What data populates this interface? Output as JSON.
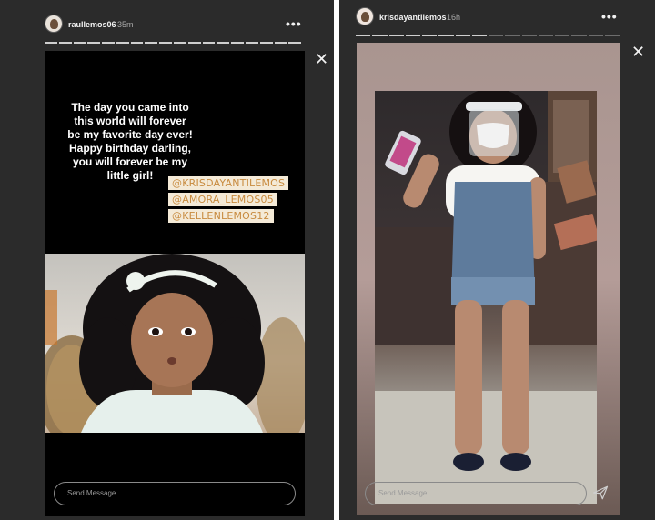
{
  "left": {
    "username": "raullemos06",
    "time": "35m",
    "more": "•••",
    "close": "✕",
    "progress_segments": 18,
    "story_text": "The day you came into this world will forever be my favorite day ever! Happy birthday darling, you will forever be my little girl!",
    "tags": [
      "@KRISDAYANTILEMOS",
      "@AMORA_LEMOS05",
      "@KELLENLEMOS12"
    ],
    "message_placeholder": "Send Message"
  },
  "right": {
    "username": "krisdayantilemos",
    "time": "16h",
    "more": "•••",
    "close": "✕",
    "progress_segments": 16,
    "progress_viewed": 8,
    "message_placeholder": "Send Message"
  },
  "colors": {
    "panel_bg": "#2b2b2b",
    "tag_bg": "#f4ead7",
    "tag_text": "#c88b3f"
  },
  "icons": [
    "more-options-icon",
    "close-icon",
    "send-icon",
    "avatar"
  ]
}
